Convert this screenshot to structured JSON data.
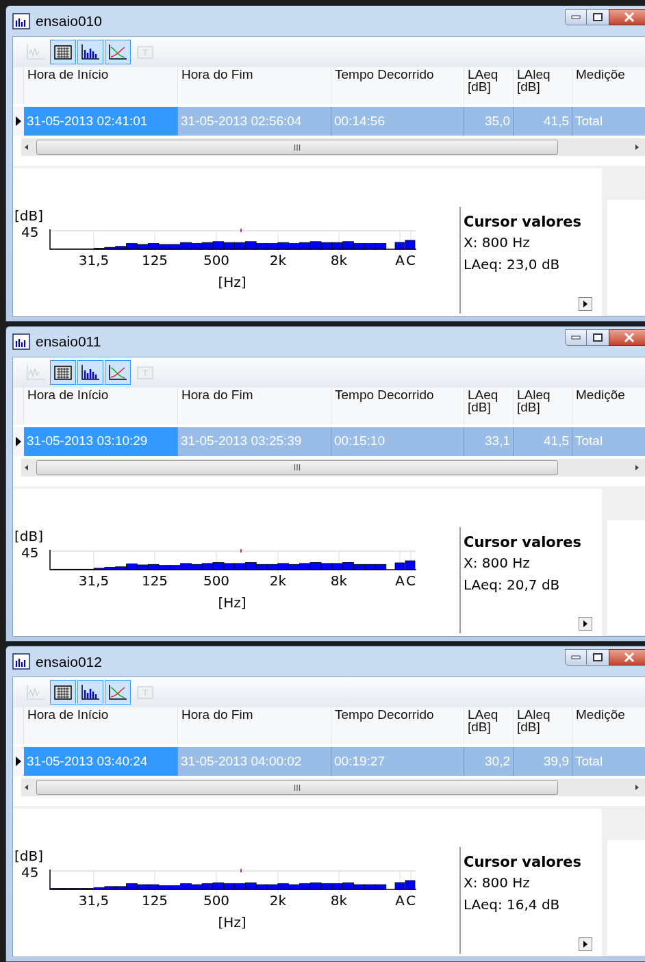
{
  "windows": [
    {
      "title": "ensaio010",
      "toolbar": [
        {
          "kind": "time-history",
          "selected": false,
          "disabled": true
        },
        {
          "kind": "table",
          "selected": true,
          "disabled": false
        },
        {
          "kind": "spectrum",
          "selected": true,
          "disabled": false
        },
        {
          "kind": "statistics",
          "selected": true,
          "disabled": false
        },
        {
          "kind": "marker",
          "selected": false,
          "disabled": true
        }
      ],
      "table": {
        "columns": [
          {
            "label": "Hora de Início",
            "numeric": false
          },
          {
            "label": "Hora do Fim",
            "numeric": false
          },
          {
            "label": "Tempo Decorrido",
            "numeric": false
          },
          {
            "label": "LAeq [dB]",
            "numeric": true
          },
          {
            "label": "LAleq [dB]",
            "numeric": true
          },
          {
            "label": "Mediçõe",
            "numeric": false
          }
        ],
        "rows": [
          {
            "selected": true,
            "cells": [
              "31-05-2013 02:41:01",
              "31-05-2013 02:56:04",
              "00:14:56",
              "35,0",
              "41,5",
              "Total"
            ]
          }
        ]
      },
      "chart": {
        "ylabel": "[dB]",
        "ytick": "45",
        "xticks": [
          "31,5",
          "125",
          "500",
          "2k",
          "8k",
          "A",
          "C"
        ],
        "xlabel": "[Hz]"
      },
      "cursor": {
        "title": "Cursor valores",
        "x": "X: 800 Hz",
        "value": "LAeq: 23,0 dB"
      }
    },
    {
      "title": "ensaio011",
      "toolbar": [
        {
          "kind": "time-history",
          "selected": false,
          "disabled": true
        },
        {
          "kind": "table",
          "selected": true,
          "disabled": false
        },
        {
          "kind": "spectrum",
          "selected": true,
          "disabled": false
        },
        {
          "kind": "statistics",
          "selected": true,
          "disabled": false
        },
        {
          "kind": "marker",
          "selected": false,
          "disabled": true
        }
      ],
      "table": {
        "columns": [
          {
            "label": "Hora de Início",
            "numeric": false
          },
          {
            "label": "Hora do Fim",
            "numeric": false
          },
          {
            "label": "Tempo Decorrido",
            "numeric": false
          },
          {
            "label": "LAeq [dB]",
            "numeric": true
          },
          {
            "label": "LAleq [dB]",
            "numeric": true
          },
          {
            "label": "Mediçõe",
            "numeric": false
          }
        ],
        "rows": [
          {
            "selected": true,
            "cells": [
              "31-05-2013 03:10:29",
              "31-05-2013 03:25:39",
              "00:15:10",
              "33,1",
              "41,5",
              "Total"
            ]
          }
        ]
      },
      "chart": {
        "ylabel": "[dB]",
        "ytick": "45",
        "xticks": [
          "31,5",
          "125",
          "500",
          "2k",
          "8k",
          "A",
          "C"
        ],
        "xlabel": "[Hz]"
      },
      "cursor": {
        "title": "Cursor valores",
        "x": "X: 800 Hz",
        "value": "LAeq: 20,7 dB"
      }
    },
    {
      "title": "ensaio012",
      "toolbar": [
        {
          "kind": "time-history",
          "selected": false,
          "disabled": true
        },
        {
          "kind": "table",
          "selected": true,
          "disabled": false
        },
        {
          "kind": "spectrum",
          "selected": true,
          "disabled": false
        },
        {
          "kind": "statistics",
          "selected": true,
          "disabled": false
        },
        {
          "kind": "marker",
          "selected": false,
          "disabled": true
        }
      ],
      "table": {
        "columns": [
          {
            "label": "Hora de Início",
            "numeric": false
          },
          {
            "label": "Hora do Fim",
            "numeric": false
          },
          {
            "label": "Tempo Decorrido",
            "numeric": false
          },
          {
            "label": "LAeq [dB]",
            "numeric": true
          },
          {
            "label": "LAleq [dB]",
            "numeric": true
          },
          {
            "label": "Mediçõe",
            "numeric": false
          }
        ],
        "rows": [
          {
            "selected": true,
            "cells": [
              "31-05-2013 03:40:24",
              "31-05-2013 04:00:02",
              "00:19:27",
              "30,2",
              "39,9",
              "Total"
            ]
          }
        ]
      },
      "chart": {
        "ylabel": "[dB]",
        "ytick": "45",
        "xticks": [
          "31,5",
          "125",
          "500",
          "2k",
          "8k",
          "A",
          "C"
        ],
        "xlabel": "[Hz]"
      },
      "cursor": {
        "title": "Cursor valores",
        "x": "X: 800 Hz",
        "value": "LAeq: 16,4 dB"
      }
    }
  ]
}
